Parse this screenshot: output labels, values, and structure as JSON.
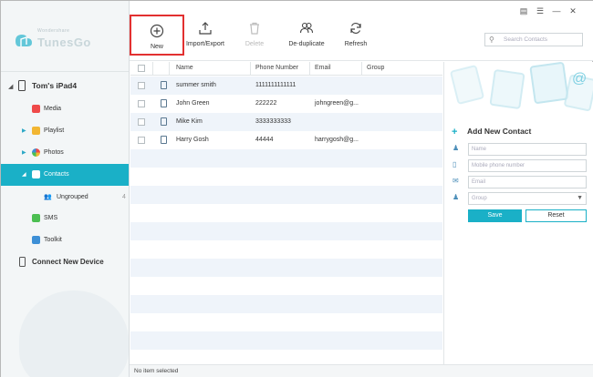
{
  "app": {
    "logo_small": "Wondershare",
    "logo_name": "TunesGo"
  },
  "sidebar": {
    "device": "Tom's iPad4",
    "items": [
      {
        "label": "Media",
        "icon": "music-icon",
        "color": "#ef4a4a"
      },
      {
        "label": "Playlist",
        "icon": "playlist-icon",
        "color": "#f2b632"
      },
      {
        "label": "Photos",
        "icon": "photos-icon",
        "color": "#e87d3e"
      },
      {
        "label": "Contacts",
        "icon": "contacts-icon",
        "color": "#ffffff"
      },
      {
        "label": "SMS",
        "icon": "sms-icon",
        "color": "#4cbf52"
      },
      {
        "label": "Toolkit",
        "icon": "toolkit-icon",
        "color": "#3d8fd6"
      }
    ],
    "sub_items": [
      {
        "label": "Ungrouped",
        "count": "4"
      }
    ],
    "connect": "Connect New Device"
  },
  "toolbar": {
    "new": "New",
    "import_export": "Import/Export",
    "delete": "Delete",
    "deduplicate": "De-duplicate",
    "refresh": "Refresh",
    "search_placeholder": "Search Contacts"
  },
  "table": {
    "headers": {
      "name": "Name",
      "phone": "Phone Number",
      "email": "Email",
      "group": "Group"
    },
    "rows": [
      {
        "name": "summer smith",
        "phone": "1111111111111",
        "email": "",
        "group": ""
      },
      {
        "name": "John Green",
        "phone": "222222",
        "email": "johngreen@g...",
        "group": ""
      },
      {
        "name": "Mike Kim",
        "phone": "3333333333",
        "email": "",
        "group": ""
      },
      {
        "name": "Harry Gosh",
        "phone": "44444",
        "email": "harrygosh@g...",
        "group": ""
      }
    ]
  },
  "panel": {
    "title": "Add New Contact",
    "name_placeholder": "Name",
    "phone_placeholder": "Mobile phone number",
    "email_placeholder": "Email",
    "group_placeholder": "Group",
    "save": "Save",
    "reset": "Reset"
  },
  "status": {
    "text": "No item selected"
  },
  "colors": {
    "accent": "#1ab0c7",
    "highlight": "#e23030"
  }
}
